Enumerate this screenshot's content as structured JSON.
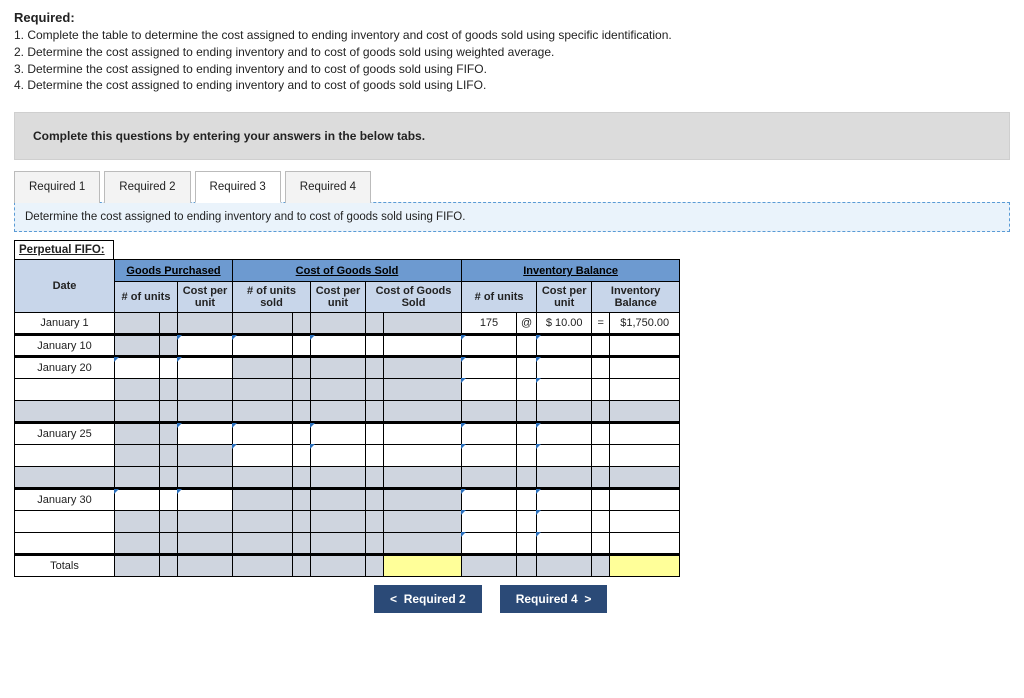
{
  "required": {
    "title": "Required:",
    "items": [
      "1. Complete the table to determine the cost assigned to ending inventory and cost of goods sold using specific identification.",
      "2. Determine the cost assigned to ending inventory and to cost of goods sold using weighted average.",
      "3. Determine the cost assigned to ending inventory and to cost of goods sold using FIFO.",
      "4. Determine the cost assigned to ending inventory and to cost of goods sold using LIFO."
    ]
  },
  "instruction_banner": "Complete this questions by entering your answers in the below tabs.",
  "tabs": {
    "items": [
      {
        "label": "Required 1",
        "active": false
      },
      {
        "label": "Required 2",
        "active": false
      },
      {
        "label": "Required 3",
        "active": true
      },
      {
        "label": "Required 4",
        "active": false
      }
    ],
    "description": "Determine the cost assigned to ending inventory and to cost of goods sold using FIFO."
  },
  "sheet_title": "Perpetual FIFO:",
  "nav": {
    "prev": "Required 2",
    "next": "Required 4"
  },
  "chart_data": {
    "type": "table",
    "section_headers": [
      "Goods Purchased",
      "Cost of Goods Sold",
      "Inventory Balance"
    ],
    "columns": {
      "date": "Date",
      "gp_units": "# of\nunits",
      "gp_cost": "Cost per\nunit",
      "cogs_units": "# of units\nsold",
      "cogs_cost": "Cost per\nunit",
      "cogs_total": "Cost of Goods\nSold",
      "inv_units": "# of units",
      "inv_cost": "Cost per\nunit",
      "inv_balance": "Inventory\nBalance"
    },
    "rows": [
      {
        "date": "January 1",
        "gp_units": "",
        "gp_cost": "",
        "cogs_units": "",
        "cogs_cost": "",
        "cogs_total": "",
        "inv_units": "175",
        "inv_at": "@",
        "inv_cost": "$ 10.00",
        "inv_eq": "=",
        "inv_balance": "$1,750.00",
        "disabled": [
          "gp_units",
          "gp_at",
          "gp_cost",
          "cogs_units",
          "cogs_at",
          "cogs_cost",
          "cogs_eq",
          "cogs_total"
        ]
      },
      {
        "date": "January 10",
        "editable": [
          "gp_cost",
          "cogs_units",
          "cogs_cost",
          "inv_units",
          "inv_cost"
        ],
        "disabled": [
          "gp_units",
          "gp_at"
        ]
      },
      {
        "date": "January 20",
        "editable": [
          "gp_units",
          "gp_cost",
          "inv_units",
          "inv_cost"
        ],
        "disabled": [
          "cogs_units",
          "cogs_at",
          "cogs_cost",
          "cogs_eq",
          "cogs_total"
        ]
      },
      {
        "date": "",
        "editable": [
          "inv_units",
          "inv_cost"
        ],
        "disabled": [
          "gp_units",
          "gp_at",
          "gp_cost",
          "cogs_units",
          "cogs_at",
          "cogs_cost",
          "cogs_eq",
          "cogs_total"
        ]
      },
      {
        "date": "",
        "disabled": [
          "date",
          "gp_units",
          "gp_at",
          "gp_cost",
          "cogs_units",
          "cogs_at",
          "cogs_cost",
          "cogs_eq",
          "cogs_total",
          "inv_units",
          "inv_at",
          "inv_cost",
          "inv_eq",
          "inv_balance"
        ]
      },
      {
        "date": "January 25",
        "editable": [
          "gp_cost",
          "cogs_units",
          "cogs_cost",
          "inv_units",
          "inv_cost"
        ],
        "disabled": [
          "gp_units",
          "gp_at"
        ]
      },
      {
        "date": "",
        "editable": [
          "cogs_units",
          "cogs_cost",
          "inv_units",
          "inv_cost"
        ],
        "disabled": [
          "gp_units",
          "gp_at",
          "gp_cost"
        ]
      },
      {
        "date": "",
        "disabled": [
          "date",
          "gp_units",
          "gp_at",
          "gp_cost",
          "cogs_units",
          "cogs_at",
          "cogs_cost",
          "cogs_eq",
          "cogs_total",
          "inv_units",
          "inv_at",
          "inv_cost",
          "inv_eq",
          "inv_balance"
        ]
      },
      {
        "date": "January 30",
        "editable": [
          "gp_units",
          "gp_cost",
          "inv_units",
          "inv_cost"
        ],
        "disabled": [
          "cogs_units",
          "cogs_at",
          "cogs_cost",
          "cogs_eq",
          "cogs_total"
        ]
      },
      {
        "date": "",
        "editable": [
          "inv_units",
          "inv_cost"
        ],
        "disabled": [
          "gp_units",
          "gp_at",
          "gp_cost",
          "cogs_units",
          "cogs_at",
          "cogs_cost",
          "cogs_eq",
          "cogs_total"
        ]
      },
      {
        "date": "",
        "editable": [
          "inv_units",
          "inv_cost"
        ],
        "disabled": [
          "gp_units",
          "gp_at",
          "gp_cost",
          "cogs_units",
          "cogs_at",
          "cogs_cost",
          "cogs_eq",
          "cogs_total"
        ]
      },
      {
        "date": "Totals",
        "yellow": [
          "cogs_total",
          "inv_balance"
        ],
        "disabled": [
          "gp_units",
          "gp_at",
          "gp_cost",
          "cogs_units",
          "cogs_at",
          "cogs_cost",
          "cogs_eq",
          "inv_units",
          "inv_at",
          "inv_cost",
          "inv_eq"
        ]
      }
    ],
    "group_sep_after": [
      0,
      1,
      4,
      7,
      10
    ]
  }
}
